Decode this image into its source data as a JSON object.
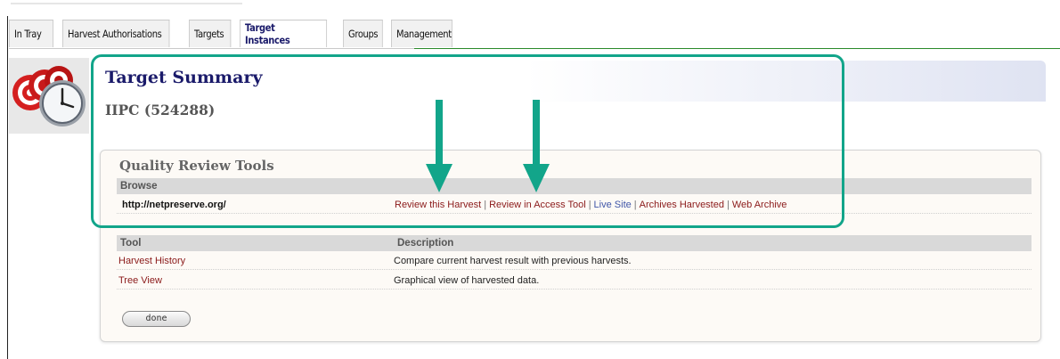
{
  "tabs": [
    {
      "label": "In Tray"
    },
    {
      "label": "Harvest Authorisations"
    },
    {
      "label": "Targets"
    },
    {
      "label": "Target Instances",
      "active": true
    },
    {
      "label": "Groups"
    },
    {
      "label": "Management"
    }
  ],
  "header": {
    "title": "Target Summary",
    "subtitle": "IIPC (524288)"
  },
  "qr": {
    "title": "Quality Review Tools",
    "browse_header": "Browse",
    "url": "http://netpreserve.org/",
    "links": {
      "review_harvest": "Review this Harvest",
      "review_access": "Review in Access Tool",
      "live_site": "Live Site",
      "archives_harvested": "Archives Harvested",
      "web_archive": "Web Archive",
      "separator": "|"
    }
  },
  "tools": {
    "col_tool": "Tool",
    "col_description": "Description",
    "rows": [
      {
        "name": "Harvest History",
        "description": "Compare current harvest result with previous harvests."
      },
      {
        "name": "Tree View",
        "description": "Graphical view of harvested data."
      }
    ]
  },
  "buttons": {
    "done": "done"
  },
  "colors": {
    "highlight": "#12a58a",
    "link": "#8b1a1a",
    "link_blue": "#4056a8",
    "title": "#1a1a6a"
  }
}
